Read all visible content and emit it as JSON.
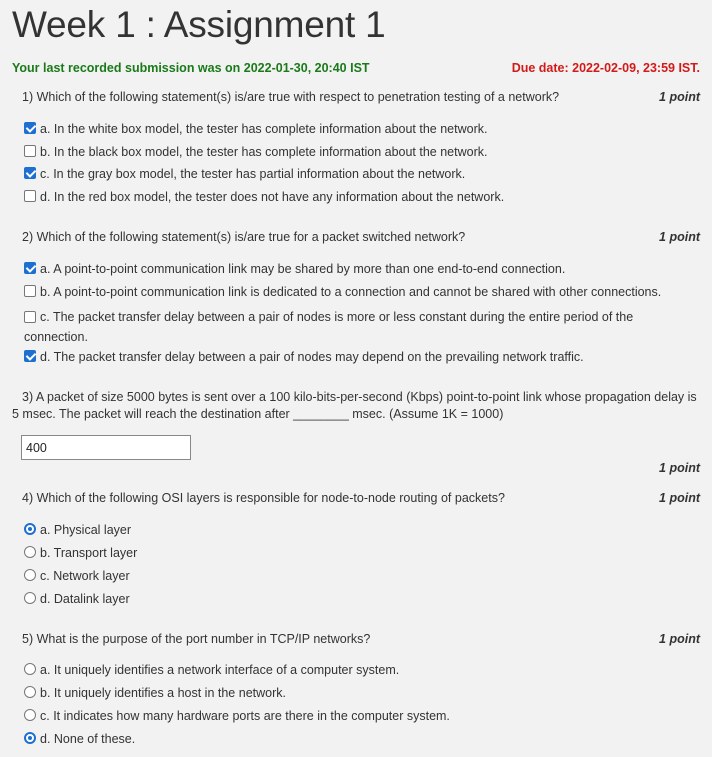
{
  "page": {
    "title": "Week 1 : Assignment 1",
    "submission_text": "Your last recorded submission was on 2022-01-30, 20:40 IST",
    "due_text": "Due date: 2022-02-09, 23:59 IST."
  },
  "colors": {
    "submitted": "#1a7a1a",
    "due": "#d21a1a",
    "accent": "#1d6fd1"
  },
  "questions": [
    {
      "text": "1)  Which of the following statement(s) is/are true with respect to penetration testing of a network?",
      "points": "1 point",
      "type": "checkbox",
      "options": [
        {
          "label": "a. In the white box model, the tester has complete information about the network.",
          "checked": true
        },
        {
          "label": "b. In the black box model, the tester has complete information about the network.",
          "checked": false
        },
        {
          "label": "c. In the gray box model, the tester has partial information about the network.",
          "checked": true
        },
        {
          "label": "d. In the red box model, the tester does not have any information about the network.",
          "checked": false
        }
      ]
    },
    {
      "text": "2)  Which of the following statement(s) is/are true for a packet switched network?",
      "points": "1 point",
      "type": "checkbox",
      "options": [
        {
          "label": "a. A point-to-point communication link may be shared by more than one end-to-end connection.",
          "checked": true
        },
        {
          "label": "b. A point-to-point communication link is dedicated to a connection and cannot be shared with other connections.",
          "checked": false
        },
        {
          "label": "c. The packet transfer delay between a pair of nodes is more or less constant during the entire period of the connection.",
          "checked": false
        },
        {
          "label": "d. The packet transfer delay between a pair of nodes may depend on the prevailing network traffic.",
          "checked": true
        }
      ]
    },
    {
      "text": "3)  A packet of size 5000 bytes is sent over a 100 kilo-bits-per-second (Kbps) point-to-point link whose propagation delay is 5 msec. The packet will reach the destination after ________ msec. (Assume 1K = 1000)",
      "points": "1 point",
      "type": "text",
      "answer": "400"
    },
    {
      "text": "4)  Which of the following OSI layers is responsible for node-to-node routing of packets?",
      "points": "1 point",
      "type": "radio",
      "options": [
        {
          "label": "a. Physical layer",
          "checked": true
        },
        {
          "label": "b. Transport layer",
          "checked": false
        },
        {
          "label": "c. Network layer",
          "checked": false
        },
        {
          "label": "d. Datalink layer",
          "checked": false
        }
      ]
    },
    {
      "text": "5)  What is the purpose of the port number in TCP/IP networks?",
      "points": "1 point",
      "type": "radio",
      "options": [
        {
          "label": "a. It uniquely identifies a network interface of a computer system.",
          "checked": false
        },
        {
          "label": "b. It uniquely identifies a host in the network.",
          "checked": false
        },
        {
          "label": "c. It indicates how many hardware ports are there in the computer system.",
          "checked": false
        },
        {
          "label": "d. None of these.",
          "checked": true
        }
      ]
    }
  ]
}
